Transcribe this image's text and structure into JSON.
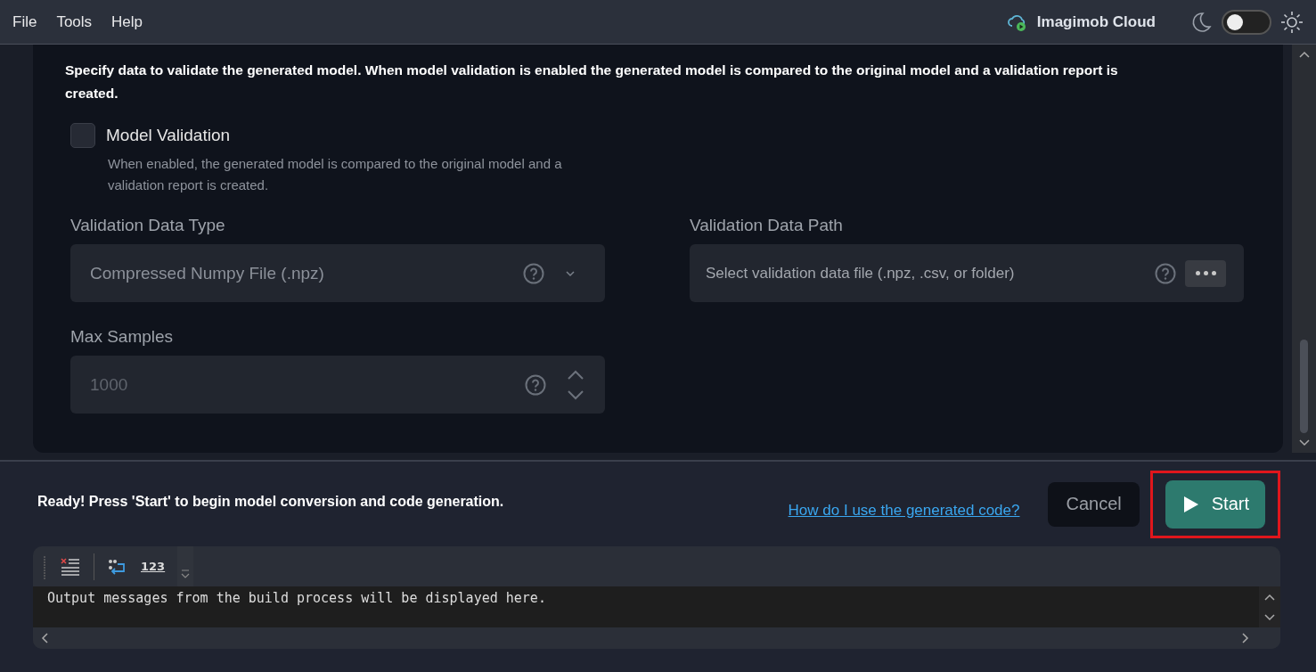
{
  "menu": [
    {
      "label": "File"
    },
    {
      "label": "Tools"
    },
    {
      "label": "Help"
    }
  ],
  "cloud": {
    "label": "Imagimob Cloud"
  },
  "theme_toggle": {
    "on": false
  },
  "validation": {
    "description": "Specify data to validate the generated model. When model validation is enabled the generated model is compared to the original model and a validation report is created.",
    "checkbox": {
      "label": "Model Validation",
      "checked": false,
      "hint": "When enabled, the generated model is compared to the original model and a validation report is created."
    },
    "data_type": {
      "label": "Validation Data Type",
      "value": "Compressed Numpy File (.npz)"
    },
    "data_path": {
      "label": "Validation Data Path",
      "placeholder": "Select validation data file (.npz, .csv, or folder)"
    },
    "max_samples": {
      "label": "Max Samples",
      "value": "1000"
    }
  },
  "status": {
    "message": "Ready! Press 'Start' to begin model conversion and code generation.",
    "help_link": "How do I use the generated code?"
  },
  "buttons": {
    "cancel": "Cancel",
    "start": "Start",
    "start_highlighted": true
  },
  "output": {
    "toolbar": [
      {
        "kind": "clear"
      },
      {
        "kind": "wrap"
      },
      {
        "kind": "numbers",
        "label": "123"
      }
    ],
    "text": "Output messages from the build process will be displayed here."
  }
}
